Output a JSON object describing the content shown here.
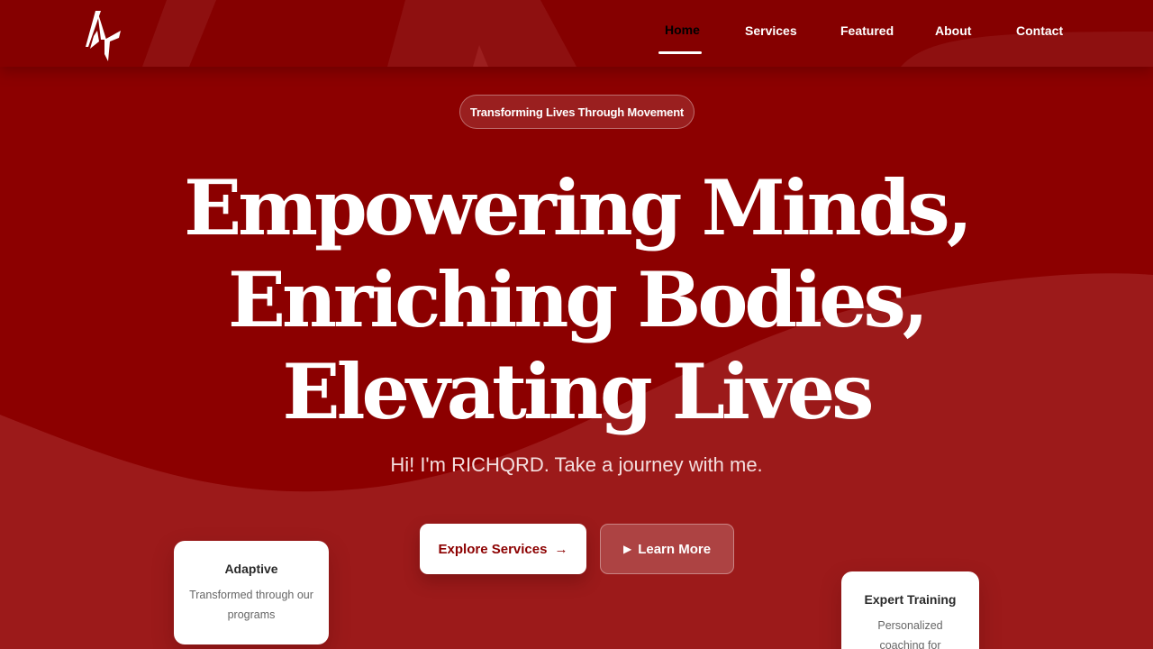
{
  "nav": {
    "items": [
      {
        "label": "Home",
        "active": true
      },
      {
        "label": "Services",
        "active": false
      },
      {
        "label": "Featured",
        "active": false
      },
      {
        "label": "About",
        "active": false
      },
      {
        "label": "Contact",
        "active": false
      }
    ]
  },
  "hero": {
    "badge": "Transforming Lives Through Movement",
    "headline": [
      "Empowering Minds,",
      "Enriching Bodies,",
      "Elevating Lives"
    ],
    "subtitle": "Hi! I'm RICHQRD. Take a journey with me.",
    "primary_button": "Explore Services",
    "primary_icon": "arrow-right-icon",
    "secondary_button": "Learn More",
    "secondary_icon": "play-icon"
  },
  "cards": [
    {
      "title": "Adaptive",
      "text": "Transformed through our programs"
    },
    {
      "title": "Expert Training",
      "text": "Personalized coaching for"
    }
  ],
  "colors": {
    "background": "#8c0000",
    "accent": "#ffffff",
    "text_dark": "#2a2a2a"
  }
}
